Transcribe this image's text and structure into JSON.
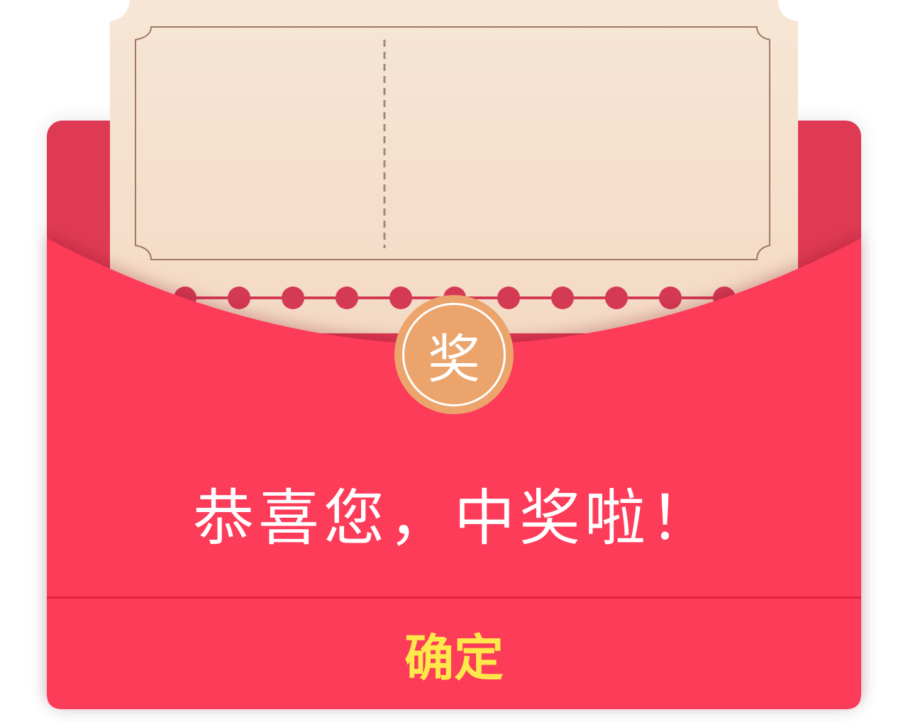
{
  "dialog": {
    "medal_label": "奖",
    "message": "恭喜您，中奖啦！",
    "confirm_label": "确定"
  },
  "colors": {
    "envelope_red": "#fd3c5a",
    "envelope_back": "#de3a54",
    "ticket_cream": "#f6dfca",
    "medal_orange": "#eba46b",
    "confirm_text": "#ffe84a",
    "dot_red": "#d53a55"
  }
}
